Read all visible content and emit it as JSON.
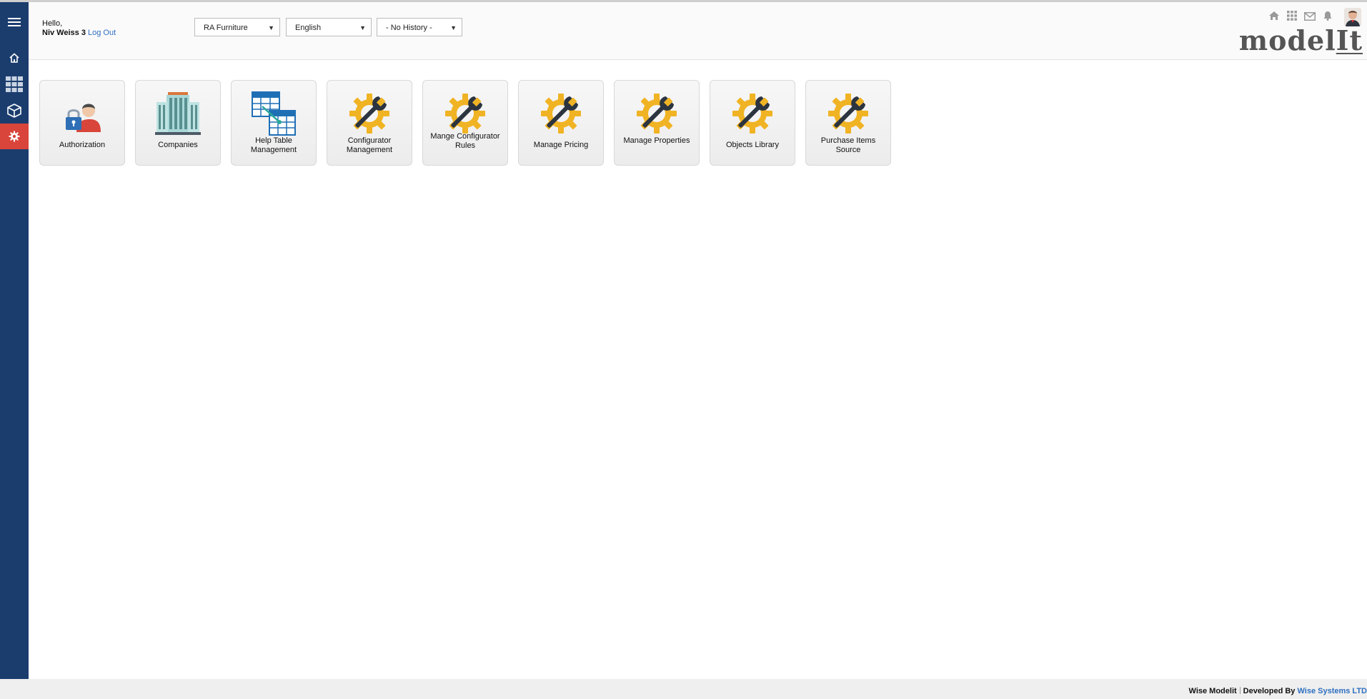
{
  "header": {
    "greeting": "Hello,",
    "user_name": "Niv Weiss 3",
    "logout_label": "Log Out",
    "company_select": "RA Furniture",
    "language_select": "English",
    "history_select": "- No History -",
    "logo_main": "model",
    "logo_suffix": "It"
  },
  "sidebar": {
    "items": [
      {
        "icon": "menu-icon"
      },
      {
        "icon": "home-icon"
      },
      {
        "icon": "grid-icon"
      },
      {
        "icon": "cube-icon"
      },
      {
        "icon": "gear-icon",
        "active": true
      }
    ]
  },
  "top_icons": [
    "home-icon",
    "apps-grid-icon",
    "mail-icon",
    "bell-icon",
    "avatar"
  ],
  "tiles": [
    {
      "label": "Authorization",
      "icon": "authorization-icon"
    },
    {
      "label": "Companies",
      "icon": "companies-icon"
    },
    {
      "label": "Help Table Management",
      "icon": "help-table-icon"
    },
    {
      "label": "Configurator Management",
      "icon": "wrench-gear-icon"
    },
    {
      "label": "Mange Configurator Rules",
      "icon": "wrench-gear-icon"
    },
    {
      "label": "Manage Pricing",
      "icon": "wrench-gear-icon"
    },
    {
      "label": "Manage Properties",
      "icon": "wrench-gear-icon"
    },
    {
      "label": "Objects Library",
      "icon": "wrench-gear-icon"
    },
    {
      "label": "Purchase Items Source",
      "icon": "wrench-gear-icon"
    }
  ],
  "footer": {
    "product": "Wise Modelit",
    "developed_by": "Developed By",
    "company_link": "Wise Systems LTD"
  },
  "colors": {
    "sidebar": "#1b3d6e",
    "active_item": "#d9453a",
    "link": "#2f6fbf",
    "gear": "#f0b323"
  }
}
